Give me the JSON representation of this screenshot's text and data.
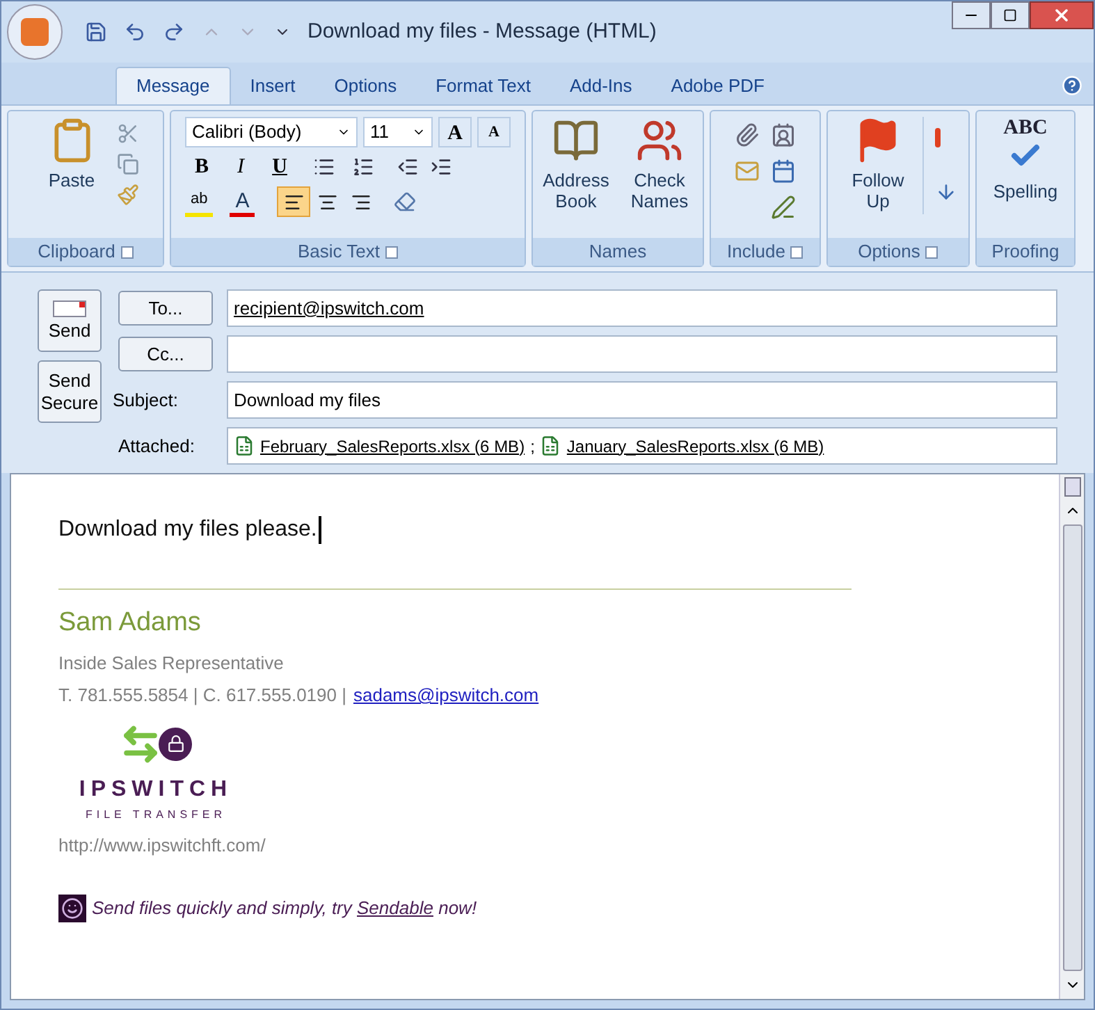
{
  "window": {
    "title": "Download my files - Message (HTML)"
  },
  "tabs": [
    {
      "label": "Message",
      "selected": true
    },
    {
      "label": "Insert",
      "selected": false
    },
    {
      "label": "Options",
      "selected": false
    },
    {
      "label": "Format Text",
      "selected": false
    },
    {
      "label": "Add-Ins",
      "selected": false
    },
    {
      "label": "Adobe PDF",
      "selected": false
    }
  ],
  "ribbon": {
    "groups": [
      {
        "kind": "clipboard",
        "label": "Clipboard",
        "launcher": true,
        "paste": "Paste"
      },
      {
        "kind": "basic_text",
        "label": "Basic Text",
        "launcher": true,
        "font": "Calibri (Body)",
        "size": "11",
        "grow": "A",
        "shrink": "A",
        "format_buttons": [
          {
            "label": "B"
          },
          {
            "label": "I"
          },
          {
            "label": "U"
          }
        ],
        "highlight": "ab",
        "font_color": "A",
        "align": [
          {
            "selected": true
          },
          {
            "selected": false
          },
          {
            "selected": false
          }
        ]
      },
      {
        "kind": "names",
        "label": "Names",
        "launcher": false,
        "buttons": [
          "Address Book",
          "Check Names"
        ]
      },
      {
        "kind": "include",
        "label": "Include",
        "launcher": true
      },
      {
        "kind": "options",
        "label": "Options",
        "launcher": true,
        "follow_up": "Follow Up"
      },
      {
        "kind": "proofing",
        "label": "Proofing",
        "launcher": false,
        "spelling": "Spelling",
        "icon_text": "ABC"
      }
    ]
  },
  "send_buttons": [
    "Send",
    "Send Secure"
  ],
  "fields": [
    {
      "kind": "button",
      "label": "To...",
      "value": "recipient@ipswitch.com"
    },
    {
      "kind": "button",
      "label": "Cc..."
    },
    {
      "kind": "label",
      "label": "Subject:",
      "value": "Download my files"
    }
  ],
  "attachments": {
    "label": "Attached:",
    "separator": ";",
    "files": [
      "February_SalesReports.xlsx (6 MB)",
      "January_SalesReports.xlsx (6 MB)"
    ]
  },
  "body": {
    "text": "Download my files please.",
    "signature": {
      "name": "Sam Adams",
      "title": "Inside Sales Representative",
      "phone": "T. 781.555.5854 | C. 617.555.0190 |",
      "email": "sadams@ipswitch.com",
      "logo_name": "IPSWITCH",
      "logo_tagline": "FILE TRANSFER",
      "url": "http://www.ipswitchft.com/"
    },
    "promo": {
      "before": "Send files quickly and simply, try",
      "link": "Sendable",
      "after": "now!"
    }
  }
}
